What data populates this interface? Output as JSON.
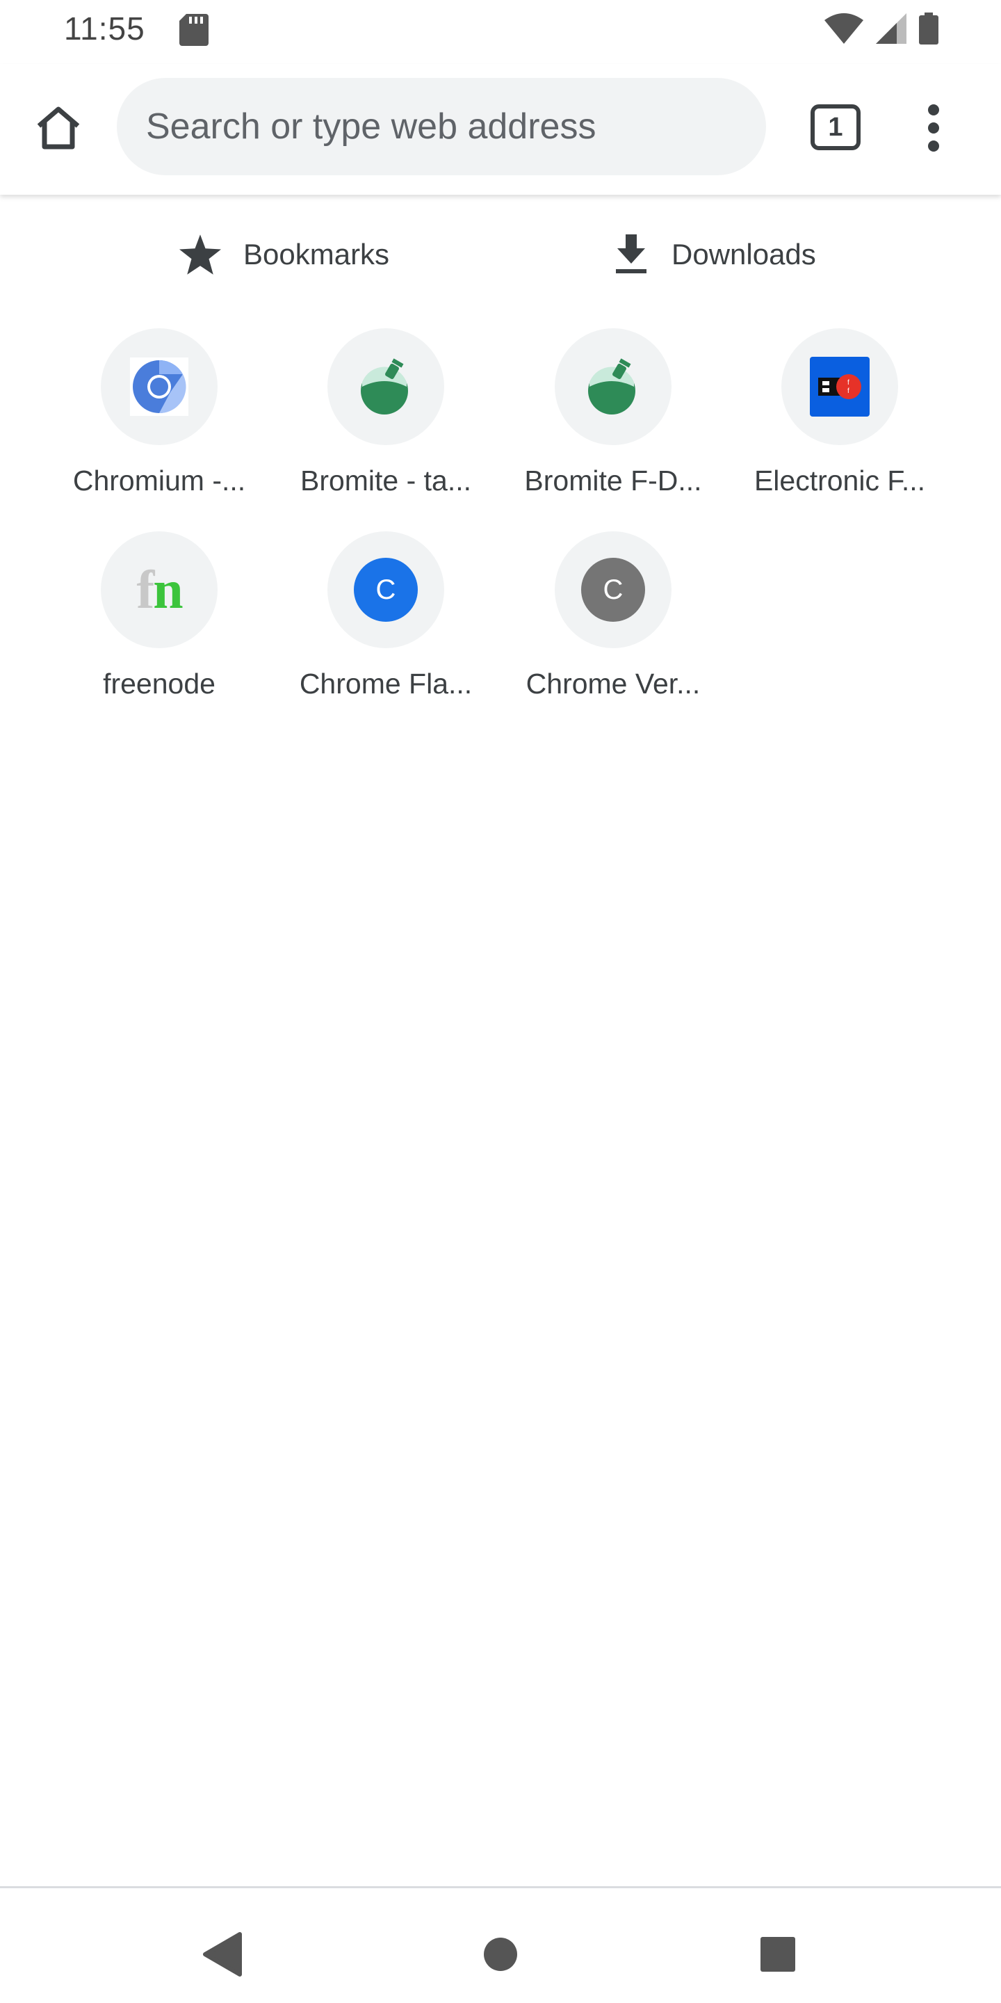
{
  "status_bar": {
    "time": "11:55",
    "icons": [
      "sd-card-icon",
      "wifi-icon",
      "cell-signal-icon",
      "battery-icon"
    ]
  },
  "toolbar": {
    "omnibox_placeholder": "Search or type web address",
    "tab_count": "1",
    "icons": [
      "home-icon",
      "tab-switcher-icon",
      "overflow-menu-icon"
    ]
  },
  "quick_links": {
    "bookmarks_label": "Bookmarks",
    "downloads_label": "Downloads"
  },
  "tiles": [
    {
      "label": "Chromium -...",
      "icon": "chromium-icon"
    },
    {
      "label": "Bromite - ta...",
      "icon": "bromite-icon"
    },
    {
      "label": "Bromite F-D...",
      "icon": "bromite-icon"
    },
    {
      "label": "Electronic F...",
      "icon": "eff-icon"
    },
    {
      "label": "freenode",
      "icon": "freenode-icon",
      "icon_text": "fn"
    },
    {
      "label": "Chrome Fla...",
      "icon": "letter-icon",
      "letter": "C",
      "color": "#1a73e8"
    },
    {
      "label": "Chrome Ver...",
      "icon": "letter-icon",
      "letter": "C",
      "color": "#757575"
    }
  ],
  "nav_bar": {
    "icons": [
      "back-icon",
      "home-circle-icon",
      "recents-icon"
    ]
  },
  "colors": {
    "accent": "#1a73e8",
    "bromite_green": "#2e8b57",
    "omnibox_bg": "#f1f3f4",
    "tile_bg": "#f1f3f4"
  }
}
